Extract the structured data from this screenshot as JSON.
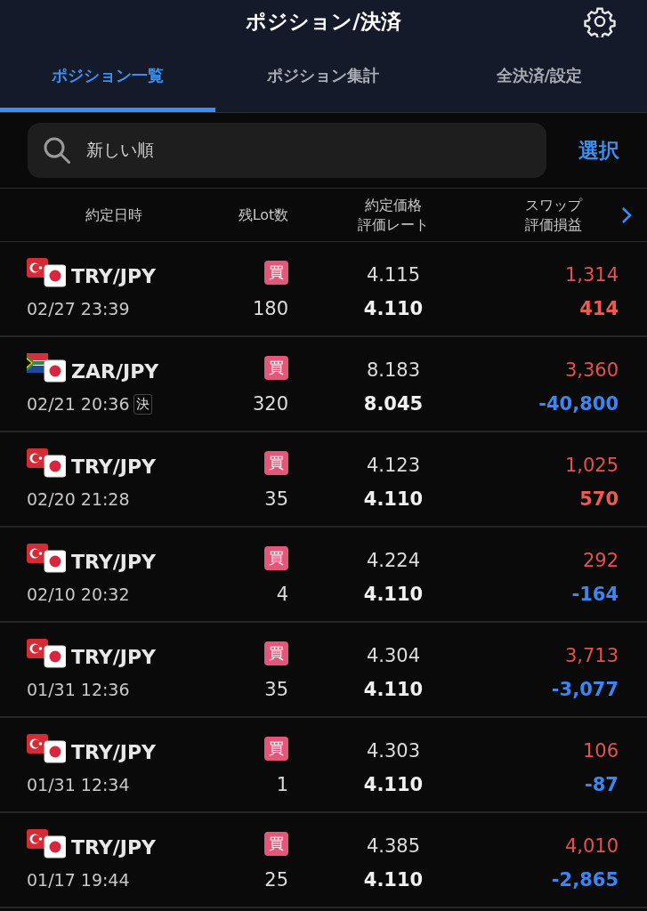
{
  "header": {
    "title": "ポジション/決済"
  },
  "tabs": [
    {
      "label": "ポジション一覧",
      "selected": true
    },
    {
      "label": "ポジション集計",
      "selected": false
    },
    {
      "label": "全決済/設定",
      "selected": false
    }
  ],
  "sort_field": {
    "value": "新しい順"
  },
  "select_button": "選択",
  "columns": [
    {
      "lines": [
        "約定日時"
      ]
    },
    {
      "lines": [
        "残Lot数"
      ]
    },
    {
      "lines": [
        "約定価格",
        "評価レート"
      ]
    },
    {
      "lines": [
        "スワップ",
        "評価損益"
      ]
    }
  ],
  "positions": [
    {
      "kind": "turkey",
      "pair": "TRY/JPY",
      "datetime": "02/27 23:39",
      "side": "買",
      "lots": "180",
      "price": "4.115",
      "rate": "4.110",
      "swap": "1,314",
      "swap_negative": false,
      "pnl": "414",
      "pnl_negative": false
    },
    {
      "kind": "south-africa",
      "pair": "ZAR/JPY",
      "datetime": "02/21 20:36",
      "settle_mark": "決",
      "side": "買",
      "lots": "320",
      "price": "8.183",
      "rate": "8.045",
      "swap": "3,360",
      "swap_negative": false,
      "pnl": "-40,800",
      "pnl_negative": true
    },
    {
      "kind": "turkey",
      "pair": "TRY/JPY",
      "datetime": "02/20 21:28",
      "side": "買",
      "lots": "35",
      "price": "4.123",
      "rate": "4.110",
      "swap": "1,025",
      "swap_negative": false,
      "pnl": "570",
      "pnl_negative": false
    },
    {
      "kind": "turkey",
      "pair": "TRY/JPY",
      "datetime": "02/10 20:32",
      "side": "買",
      "lots": "4",
      "price": "4.224",
      "rate": "4.110",
      "swap": "292",
      "swap_negative": false,
      "pnl": "-164",
      "pnl_negative": true
    },
    {
      "kind": "turkey",
      "pair": "TRY/JPY",
      "datetime": "01/31 12:36",
      "side": "買",
      "lots": "35",
      "price": "4.304",
      "rate": "4.110",
      "swap": "3,713",
      "swap_negative": false,
      "pnl": "-3,077",
      "pnl_negative": true
    },
    {
      "kind": "turkey",
      "pair": "TRY/JPY",
      "datetime": "01/31 12:34",
      "side": "買",
      "lots": "1",
      "price": "4.303",
      "rate": "4.110",
      "swap": "106",
      "swap_negative": false,
      "pnl": "-87",
      "pnl_negative": true
    },
    {
      "kind": "turkey",
      "pair": "TRY/JPY",
      "datetime": "01/17 19:44",
      "side": "買",
      "lots": "25",
      "price": "4.385",
      "rate": "4.110",
      "swap": "4,010",
      "swap_negative": false,
      "pnl": "-2,865",
      "pnl_negative": true
    }
  ]
}
